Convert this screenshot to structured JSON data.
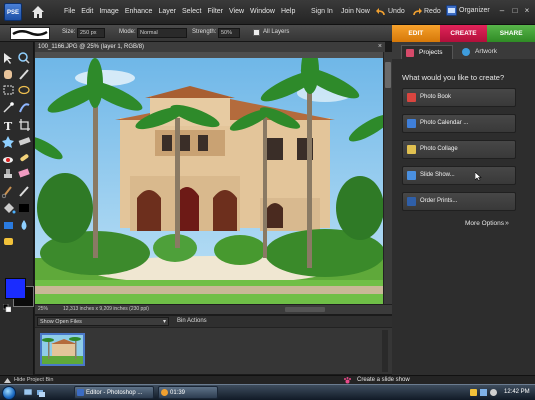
{
  "app": {
    "logo_text": "PSE"
  },
  "menu": {
    "items": [
      "File",
      "Edit",
      "Image",
      "Enhance",
      "Layer",
      "Select",
      "Filter",
      "View",
      "Window",
      "Help"
    ],
    "sign_in": "Sign In",
    "join_now": "Join Now",
    "undo": "Undo",
    "redo": "Redo",
    "organizer": "Organizer"
  },
  "options": {
    "size_label": "Size:",
    "size_value": "250 px",
    "mode_label": "Mode:",
    "mode_value": "Normal",
    "strength_label": "Strength:",
    "strength_value": "50%",
    "all_layers_label": "All Layers"
  },
  "mode_tabs": [
    "EDIT",
    "CREATE",
    "SHARE"
  ],
  "document": {
    "title": "100_1166.JPG @ 25% (layer 1, RGB/8)",
    "zoom": "25%",
    "dimensions": "12,313 inches x 9,209 inches (230 ppi)"
  },
  "bin": {
    "show_label": "Show Open Files",
    "actions_label": "Bin Actions",
    "hide_label": "Hide Project Bin"
  },
  "panel": {
    "tabs": [
      "Projects",
      "Artwork"
    ],
    "question": "What would you like to create?",
    "buttons": [
      "Photo Book",
      "Photo Calendar ...",
      "Photo Collage",
      "Slide Show...",
      "Order Prints..."
    ],
    "more_options": "More Options"
  },
  "hint": "Create a slide show",
  "taskbar": {
    "editor_button": "Editor - Photoshop ...",
    "tray_app": "01:39",
    "clock": "12:42 PM"
  },
  "colors": {
    "edit_tab": "#f39a25",
    "create_tab": "#d81b4f",
    "share_tab": "#4aa83d",
    "foreground": "#1a2cff",
    "background": "#0b0b0b"
  }
}
